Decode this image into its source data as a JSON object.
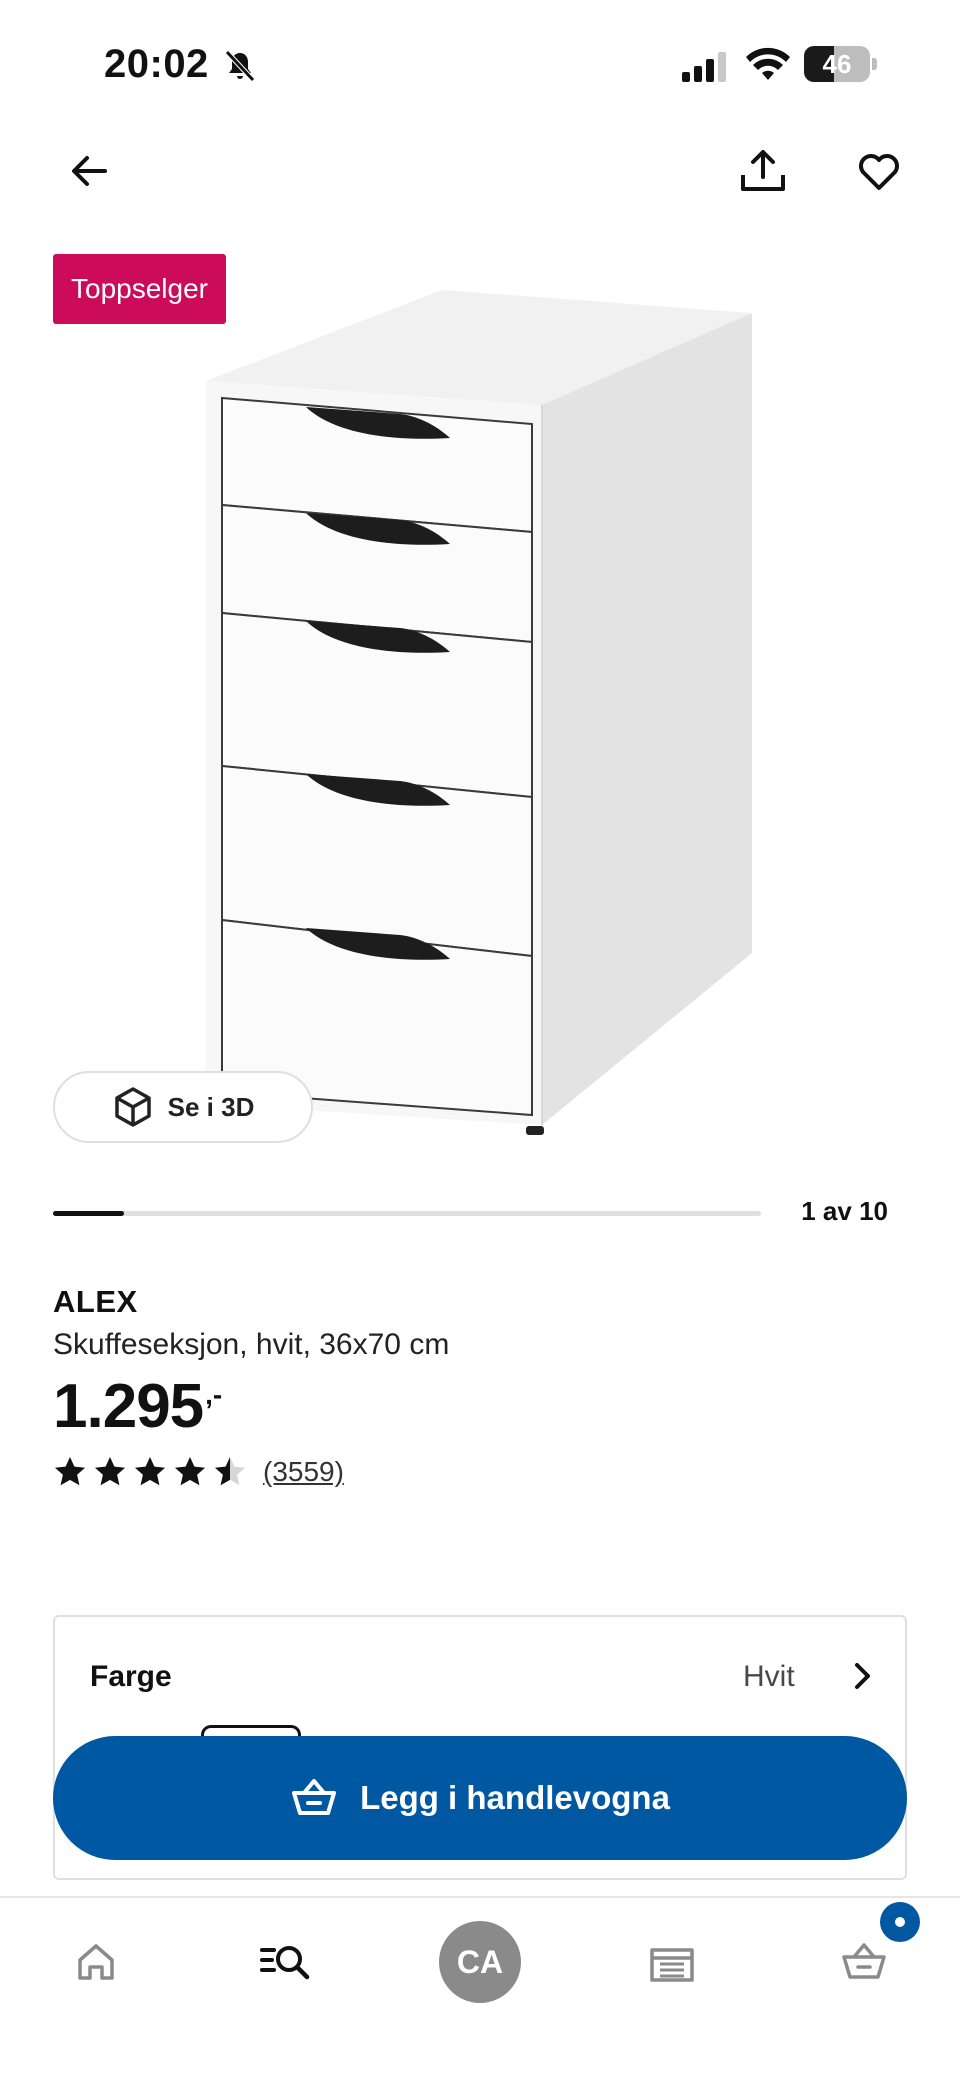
{
  "status_bar": {
    "time": "20:02",
    "battery_percent": "46",
    "battery_level": 0.46
  },
  "top_nav": {
    "icons": [
      "arrow-left-icon",
      "share-icon",
      "heart-icon"
    ]
  },
  "product": {
    "badge": "Toppselger",
    "view_3d_label": "Se i 3D",
    "carousel": {
      "current": 1,
      "total": 10,
      "label": "1 av 10"
    },
    "name": "ALEX",
    "description": "Skuffeseksjon, hvit, 36x70 cm",
    "price": "1.295",
    "price_suffix": ",-",
    "rating": {
      "value": 4.5,
      "max": 5,
      "count_label": "(3559)"
    }
  },
  "color_selector": {
    "label": "Farge",
    "value": "Hvit"
  },
  "cart_button": {
    "label": "Legg i handlevogna"
  },
  "tab_bar": {
    "profile_initials": "CA",
    "tabs": [
      "home-icon",
      "search-list-icon",
      "avatar",
      "store-icon",
      "basket-icon"
    ]
  },
  "colors": {
    "badge": "#cc0b5b",
    "primary": "#0058a3",
    "text": "#111111"
  }
}
